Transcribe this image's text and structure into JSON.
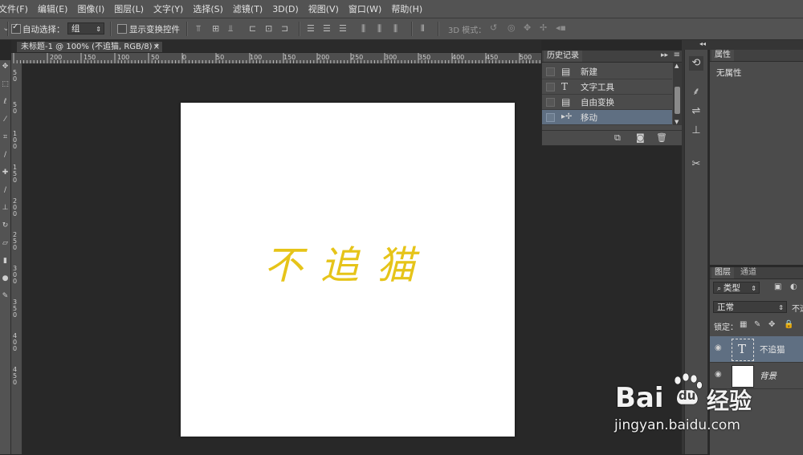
{
  "menu": [
    "文件(F)",
    "编辑(E)",
    "图像(I)",
    "图层(L)",
    "文字(Y)",
    "选择(S)",
    "滤镜(T)",
    "3D(D)",
    "视图(V)",
    "窗口(W)",
    "帮助(H)"
  ],
  "options": {
    "auto_select_label": "自动选择：",
    "auto_select_value": "组",
    "show_transform_label": "显示变换控件",
    "mode_3d_label": "3D 模式："
  },
  "document": {
    "tab_title": "未标题-1 @ 100% (不追猫, RGB/8) *",
    "close_glyph": "×",
    "canvas_text": "不追猫",
    "canvas_text_color": "#e6c419"
  },
  "ruler": {
    "h_labels": [
      "200",
      "150",
      "100",
      "50",
      "0",
      "50",
      "100",
      "150",
      "200",
      "250",
      "300",
      "350",
      "400",
      "450",
      "500"
    ],
    "v_labels": [
      "5",
      "0",
      "5",
      "0",
      "1",
      "0",
      "0",
      "1",
      "5",
      "0",
      "2",
      "0",
      "0",
      "2",
      "5",
      "0",
      "3",
      "0",
      "0",
      "3",
      "5",
      "0",
      "4",
      "0",
      "0",
      "4",
      "5",
      "0"
    ]
  },
  "history": {
    "title": "历史记录",
    "items": [
      {
        "icon": "document-icon",
        "label": "新建"
      },
      {
        "icon": "type-tool-icon",
        "label": "文字工具"
      },
      {
        "icon": "document-icon",
        "label": "自由变换"
      },
      {
        "icon": "move-tool-icon",
        "label": "移动"
      }
    ],
    "active_index": 3
  },
  "properties": {
    "title": "属性",
    "empty_label": "无属性"
  },
  "layers": {
    "tab_layers": "图层",
    "tab_channels": "通道",
    "filter_label": "类型",
    "blend_mode": "正常",
    "opacity_label": "不透",
    "lock_label": "锁定：",
    "items": [
      {
        "name": "不追猫",
        "type": "text",
        "selected": true
      },
      {
        "name": "背景",
        "type": "image",
        "selected": false
      }
    ]
  },
  "watermark": {
    "brand": "Bai",
    "brand2": "du",
    "brand_cn": "经验",
    "url": "jingyan.baidu.com"
  },
  "colors": {
    "accent_selected": "#5f6f82",
    "panel": "#4b4b4b",
    "workspace": "#282828"
  }
}
